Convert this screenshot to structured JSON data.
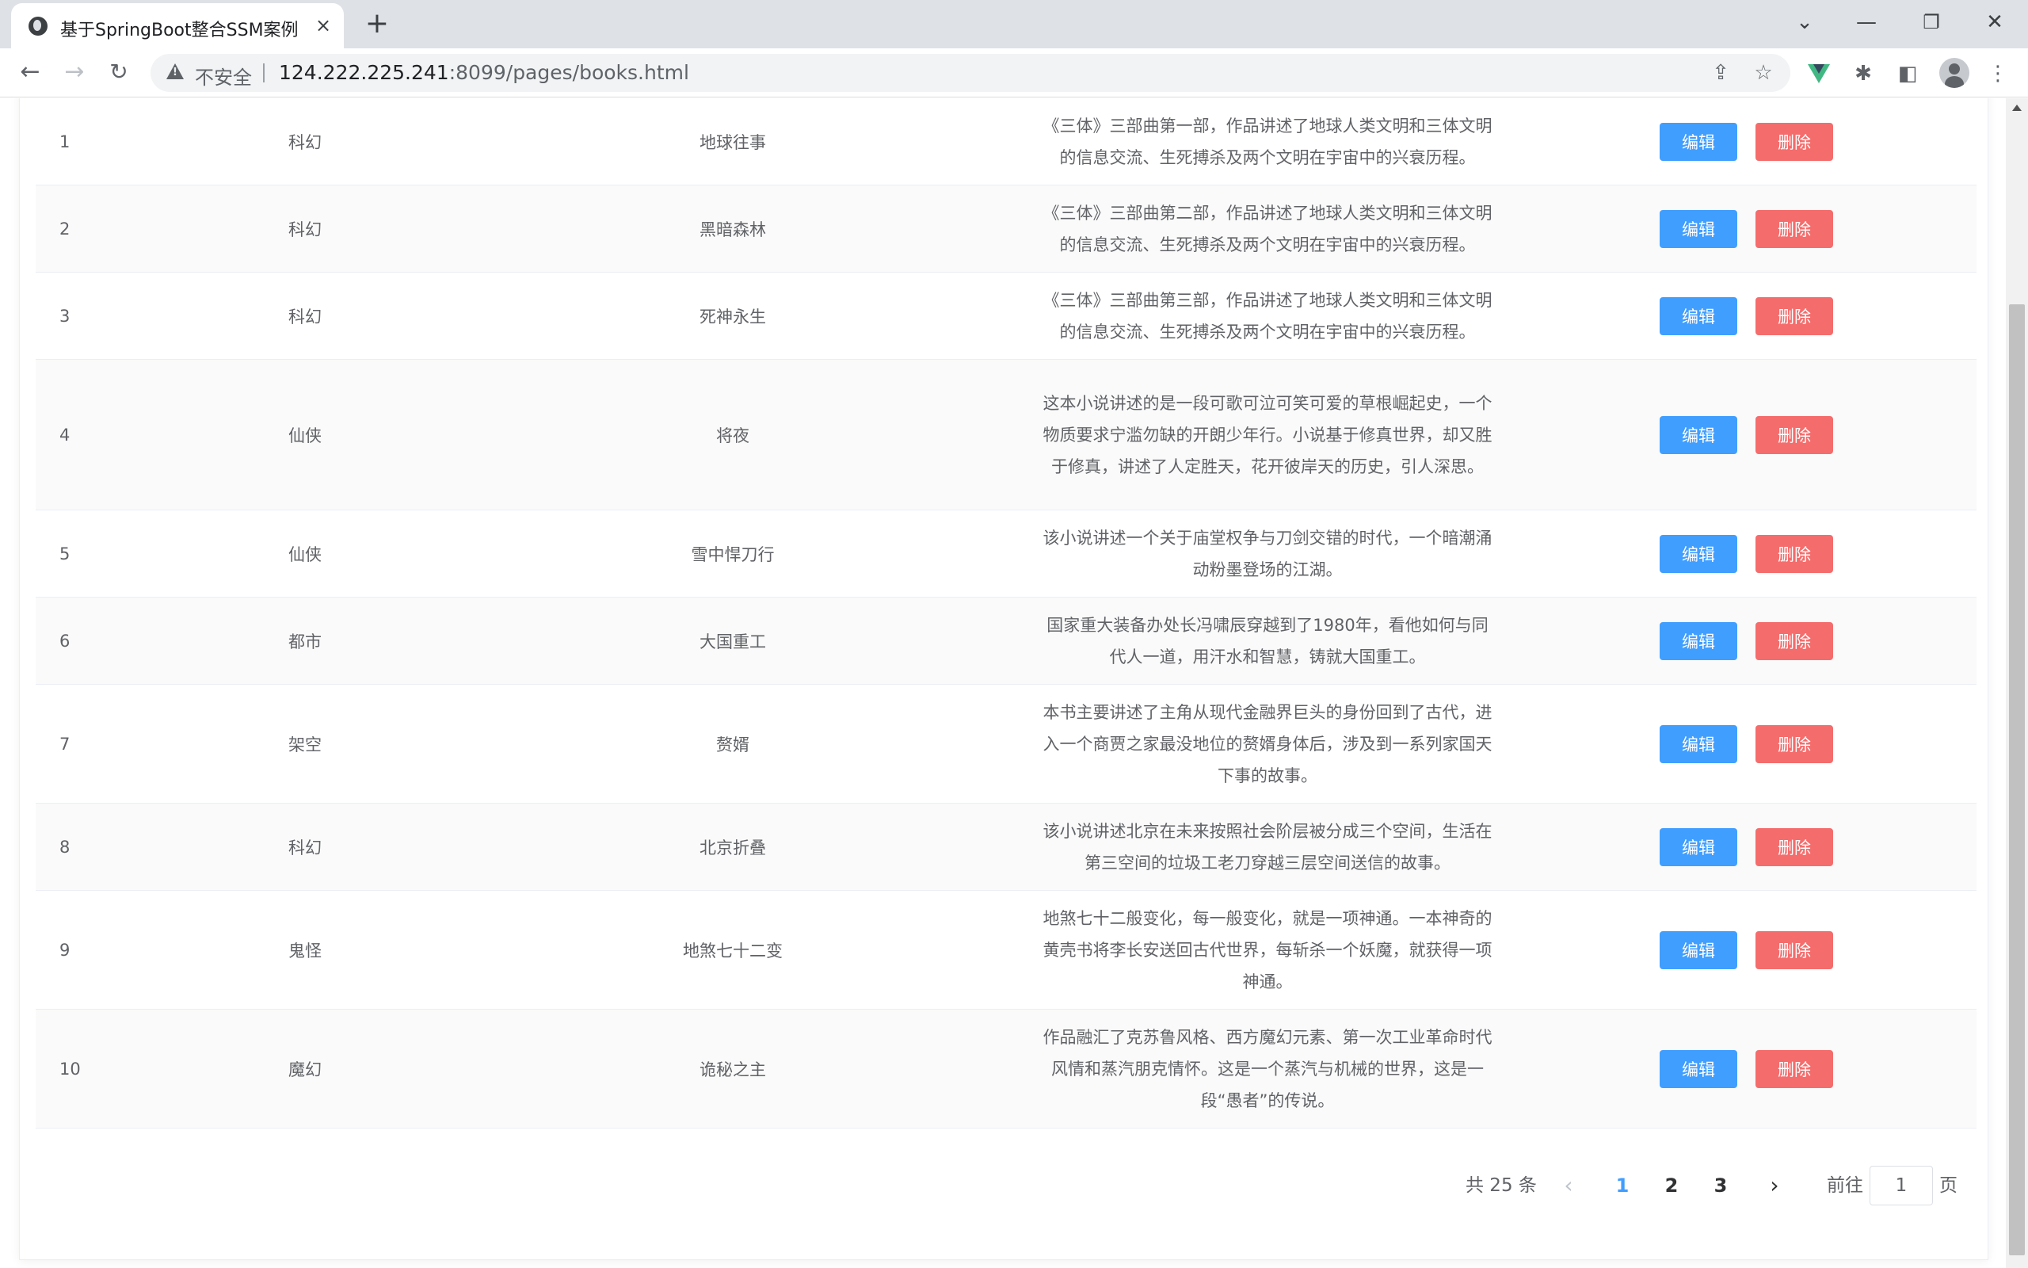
{
  "browser": {
    "tab_title": "基于SpringBoot整合SSM案例",
    "tab_close": "×",
    "new_tab": "+",
    "insecure_label": "不安全",
    "url_host": "124.222.225.241",
    "url_rest": ":8099/pages/books.html"
  },
  "table": {
    "edit_label": "编辑",
    "delete_label": "删除",
    "rows": [
      {
        "id": "1",
        "type": "科幻",
        "name": "地球往事",
        "description": "《三体》三部曲第一部，作品讲述了地球人类文明和三体文明的信息交流、生死搏杀及两个文明在宇宙中的兴衰历程。"
      },
      {
        "id": "2",
        "type": "科幻",
        "name": "黑暗森林",
        "description": "《三体》三部曲第二部，作品讲述了地球人类文明和三体文明的信息交流、生死搏杀及两个文明在宇宙中的兴衰历程。"
      },
      {
        "id": "3",
        "type": "科幻",
        "name": "死神永生",
        "description": "《三体》三部曲第三部，作品讲述了地球人类文明和三体文明的信息交流、生死搏杀及两个文明在宇宙中的兴衰历程。"
      },
      {
        "id": "4",
        "type": "仙侠",
        "name": "将夜",
        "description": "这本小说讲述的是一段可歌可泣可笑可爱的草根崛起史，一个物质要求宁滥勿缺的开朗少年行。小说基于修真世界，却又胜于修真，讲述了人定胜天，花开彼岸天的历史，引人深思。"
      },
      {
        "id": "5",
        "type": "仙侠",
        "name": "雪中悍刀行",
        "description": "该小说讲述一个关于庙堂权争与刀剑交错的时代，一个暗潮涌动粉墨登场的江湖。"
      },
      {
        "id": "6",
        "type": "都市",
        "name": "大国重工",
        "description": "国家重大装备办处长冯啸辰穿越到了1980年，看他如何与同代人一道，用汗水和智慧，铸就大国重工。"
      },
      {
        "id": "7",
        "type": "架空",
        "name": "赘婿",
        "description": "本书主要讲述了主角从现代金融界巨头的身份回到了古代，进入一个商贾之家最没地位的赘婿身体后，涉及到一系列家国天下事的故事。"
      },
      {
        "id": "8",
        "type": "科幻",
        "name": "北京折叠",
        "description": "该小说讲述北京在未来按照社会阶层被分成三个空间，生活在第三空间的垃圾工老刀穿越三层空间送信的故事。"
      },
      {
        "id": "9",
        "type": "鬼怪",
        "name": "地煞七十二变",
        "description": "地煞七十二般变化，每一般变化，就是一项神通。一本神奇的黄壳书将李长安送回古代世界，每斩杀一个妖魔，就获得一项神通。"
      },
      {
        "id": "10",
        "type": "魔幻",
        "name": "诡秘之主",
        "description": "作品融汇了克苏鲁风格、西方魔幻元素、第一次工业革命时代风情和蒸汽朋克情怀。这是一个蒸汽与机械的世界，这是一段“愚者”的传说。"
      }
    ]
  },
  "pagination": {
    "total_text": "共 25 条",
    "prev": "‹",
    "pages": [
      "1",
      "2",
      "3"
    ],
    "active_page": "1",
    "next": "›",
    "goto_label": "前往",
    "goto_value": "1",
    "page_suffix": "页"
  },
  "colors": {
    "primary": "#409eff",
    "danger": "#f56c6c"
  }
}
